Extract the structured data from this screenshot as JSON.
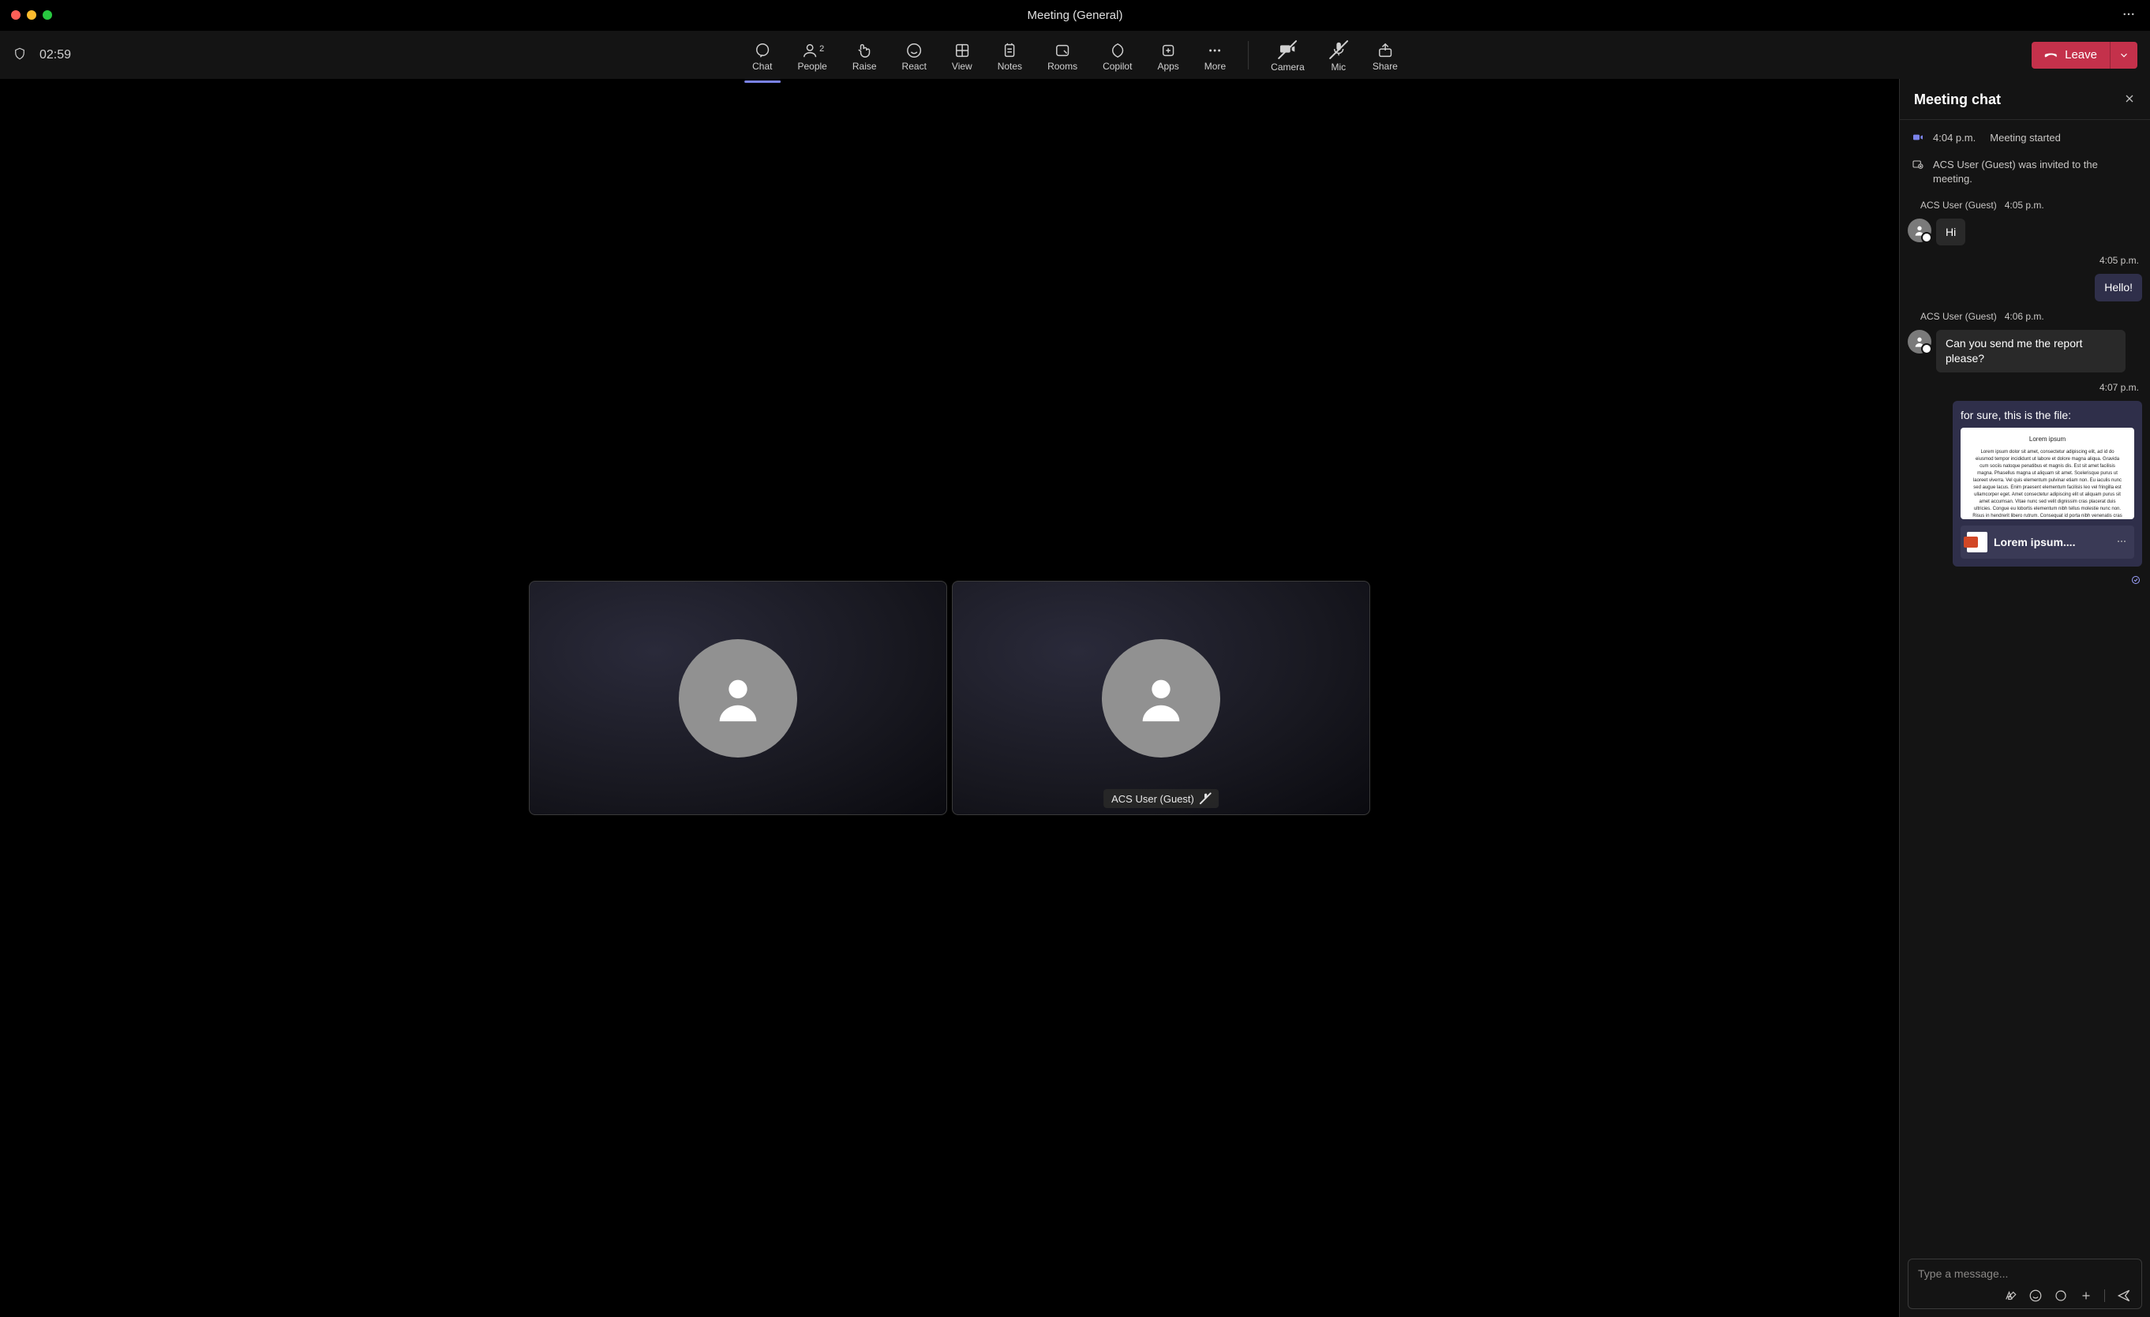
{
  "title": "Meeting (General)",
  "timer": "02:59",
  "toolbar": {
    "chat": "Chat",
    "people": "People",
    "people_count": "2",
    "raise": "Raise",
    "react": "React",
    "view": "View",
    "notes": "Notes",
    "rooms": "Rooms",
    "copilot": "Copilot",
    "apps": "Apps",
    "more": "More",
    "camera": "Camera",
    "mic": "Mic",
    "share": "Share",
    "leave": "Leave"
  },
  "participants": {
    "p1": {
      "label": ""
    },
    "p2": {
      "label": "ACS User (Guest)"
    }
  },
  "chat": {
    "title": "Meeting chat",
    "sys1_time": "4:04 p.m.",
    "sys1_text": "Meeting started",
    "sys2_text": "ACS User (Guest) was invited to the meeting.",
    "m1_name": "ACS User (Guest)",
    "m1_time": "4:05 p.m.",
    "m1_text": "Hi",
    "m2_time": "4:05 p.m.",
    "m2_text": "Hello!",
    "m3_name": "ACS User (Guest)",
    "m3_time": "4:06 p.m.",
    "m3_text": "Can you send me the report please?",
    "m4_time": "4:07 p.m.",
    "m4_text": "for sure, this is the file:",
    "file_title": "Lorem ipsum",
    "file_body": "Lorem ipsum dolor sit amet, consectetur adipiscing elit, ad id do eiusmod tempor incididunt ut labore et dolore magna aliqua. Gravida cum sociis natoque penatibus et magnis dis. Est sit amet facilisis magna. Phasellus magna ut aliquam sit amet. Scelerisque purus ut laoreet viverra. Vel quis elementum pulvinar etiam non. Eu iaculis nunc sed augue lacus. Enim praesent elementum facilisis leo vel fringilla est ullamcorper eget. Amet consectetur adipiscing elit ut aliquam purus sit amet accumsan. Vitae nunc sed velit dignissim cras placerat duis ultricies. Congue eu lobortis elementum nibh tellus molestie nunc non. Risus in hendrerit libero rutrum. Consequat id porta nibh venenatis cras sed. Nec ultrices dui sapien eget mi proin. Suspendisse in est ante in nibh.",
    "file_name": "Lorem ipsum....",
    "compose_placeholder": "Type a message..."
  }
}
